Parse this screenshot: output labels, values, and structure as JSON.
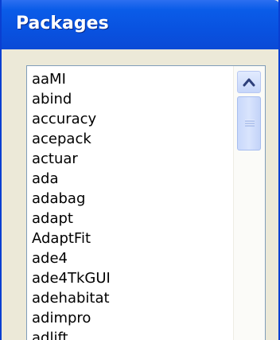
{
  "window": {
    "title": "Packages"
  },
  "package_list": {
    "items": [
      "aaMI",
      "abind",
      "accuracy",
      "acepack",
      "actuar",
      "ada",
      "adabag",
      "adapt",
      "AdaptFit",
      "ade4",
      "ade4TkGUI",
      "adehabitat",
      "adimpro",
      "adlift"
    ]
  },
  "scrollbar": {
    "up_icon": "chevron-up-icon",
    "thumb_icon": "grip-icon"
  },
  "colors": {
    "titlebar": "#0a5ce8",
    "title_text": "#ffffff",
    "window_body": "#ece9d8",
    "list_border": "#7f9db9",
    "scrollbar_accent": "#c6d6fa"
  }
}
